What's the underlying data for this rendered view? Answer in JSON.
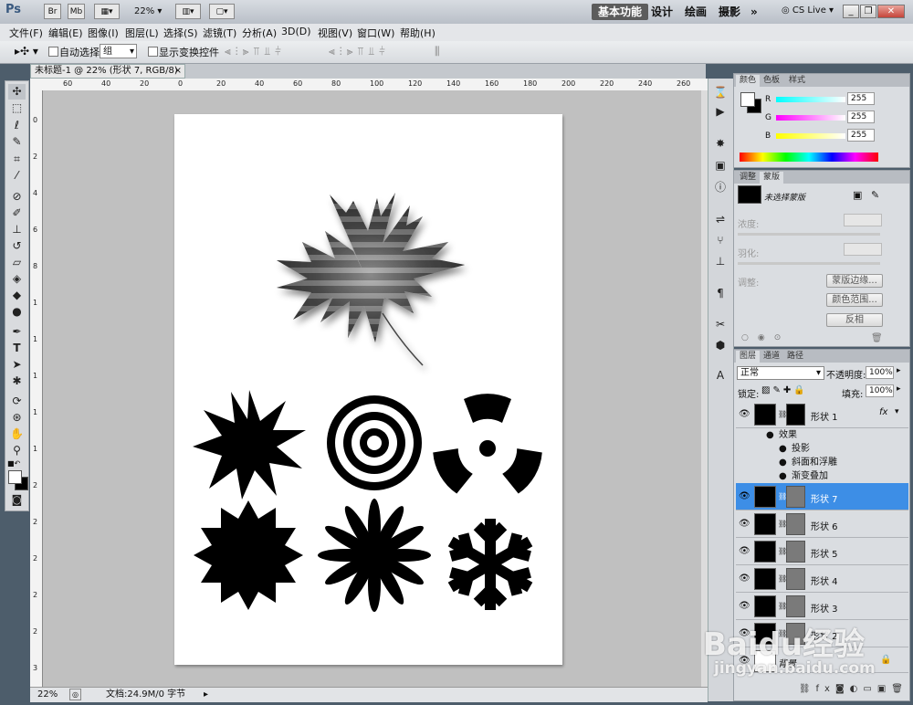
{
  "app": {
    "logo": "Ps",
    "zoom": "22%"
  },
  "titlebar": {
    "btn_br": "Br",
    "btn_mb": "Mb",
    "workspaces": [
      "基本功能",
      "设计",
      "绘画",
      "摄影"
    ],
    "more": "»",
    "cs_live": "CS Live"
  },
  "menus": [
    "文件(F)",
    "编辑(E)",
    "图像(I)",
    "图层(L)",
    "选择(S)",
    "滤镜(T)",
    "分析(A)",
    "3D(D)",
    "视图(V)",
    "窗口(W)",
    "帮助(H)"
  ],
  "options": {
    "auto_select_label": "自动选择:",
    "auto_select_value": "组",
    "show_transform_label": "显示变换控件"
  },
  "document": {
    "tab_title": "未标题-1 @ 22% (形状 7, RGB/8) *",
    "close": "×"
  },
  "ruler_top": [
    "60",
    "40",
    "20",
    "0",
    "20",
    "40",
    "60",
    "80",
    "100",
    "120",
    "140",
    "160",
    "180",
    "200",
    "220",
    "240",
    "260",
    "280",
    "300",
    "32"
  ],
  "ruler_left": [
    "0",
    "2",
    "4",
    "6",
    "8",
    "1",
    "1",
    "1",
    "1",
    "1",
    "2",
    "2",
    "2",
    "2",
    "2",
    "3"
  ],
  "statusbar": {
    "zoom": "22%",
    "doc_info": "文档:24.9M/0 字节"
  },
  "color_panel": {
    "tabs": [
      "颜色",
      "色板",
      "样式"
    ],
    "channels": [
      {
        "label": "R",
        "value": "255"
      },
      {
        "label": "G",
        "value": "255"
      },
      {
        "label": "B",
        "value": "255"
      }
    ]
  },
  "mask_panel": {
    "tabs": [
      "调整",
      "蒙版"
    ],
    "title": "未选择蒙版",
    "density_label": "浓度:",
    "feather_label": "羽化:",
    "refine_label": "调整:",
    "buttons": [
      "蒙版边缘...",
      "颜色范围...",
      "反相"
    ]
  },
  "layers_panel": {
    "tabs": [
      "图层",
      "通道",
      "路径"
    ],
    "blend_mode": "正常",
    "opacity_label": "不透明度:",
    "opacity_value": "100%",
    "lock_label": "锁定:",
    "fill_label": "填充:",
    "fill_value": "100%",
    "layers": [
      {
        "name": "形状 1",
        "fx": "fx",
        "selected": false
      },
      {
        "name": "形状 7",
        "fx": "",
        "selected": true
      },
      {
        "name": "形状 6",
        "fx": "",
        "selected": false
      },
      {
        "name": "形状 5",
        "fx": "",
        "selected": false
      },
      {
        "name": "形状 4",
        "fx": "",
        "selected": false
      },
      {
        "name": "形状 3",
        "fx": "",
        "selected": false
      },
      {
        "name": "形状 2",
        "fx": "",
        "selected": false
      },
      {
        "name": "背景",
        "fx": "",
        "selected": false
      }
    ],
    "effects_label": "效果",
    "effects": [
      "投影",
      "斜面和浮雕",
      "渐变叠加"
    ]
  },
  "watermark": {
    "brand": "Baidu经验",
    "url": "jingyan.baidu.com"
  },
  "colors": {
    "selected_layer": "#3d8ee6",
    "accent_active_ws": "#5c5c5c"
  }
}
